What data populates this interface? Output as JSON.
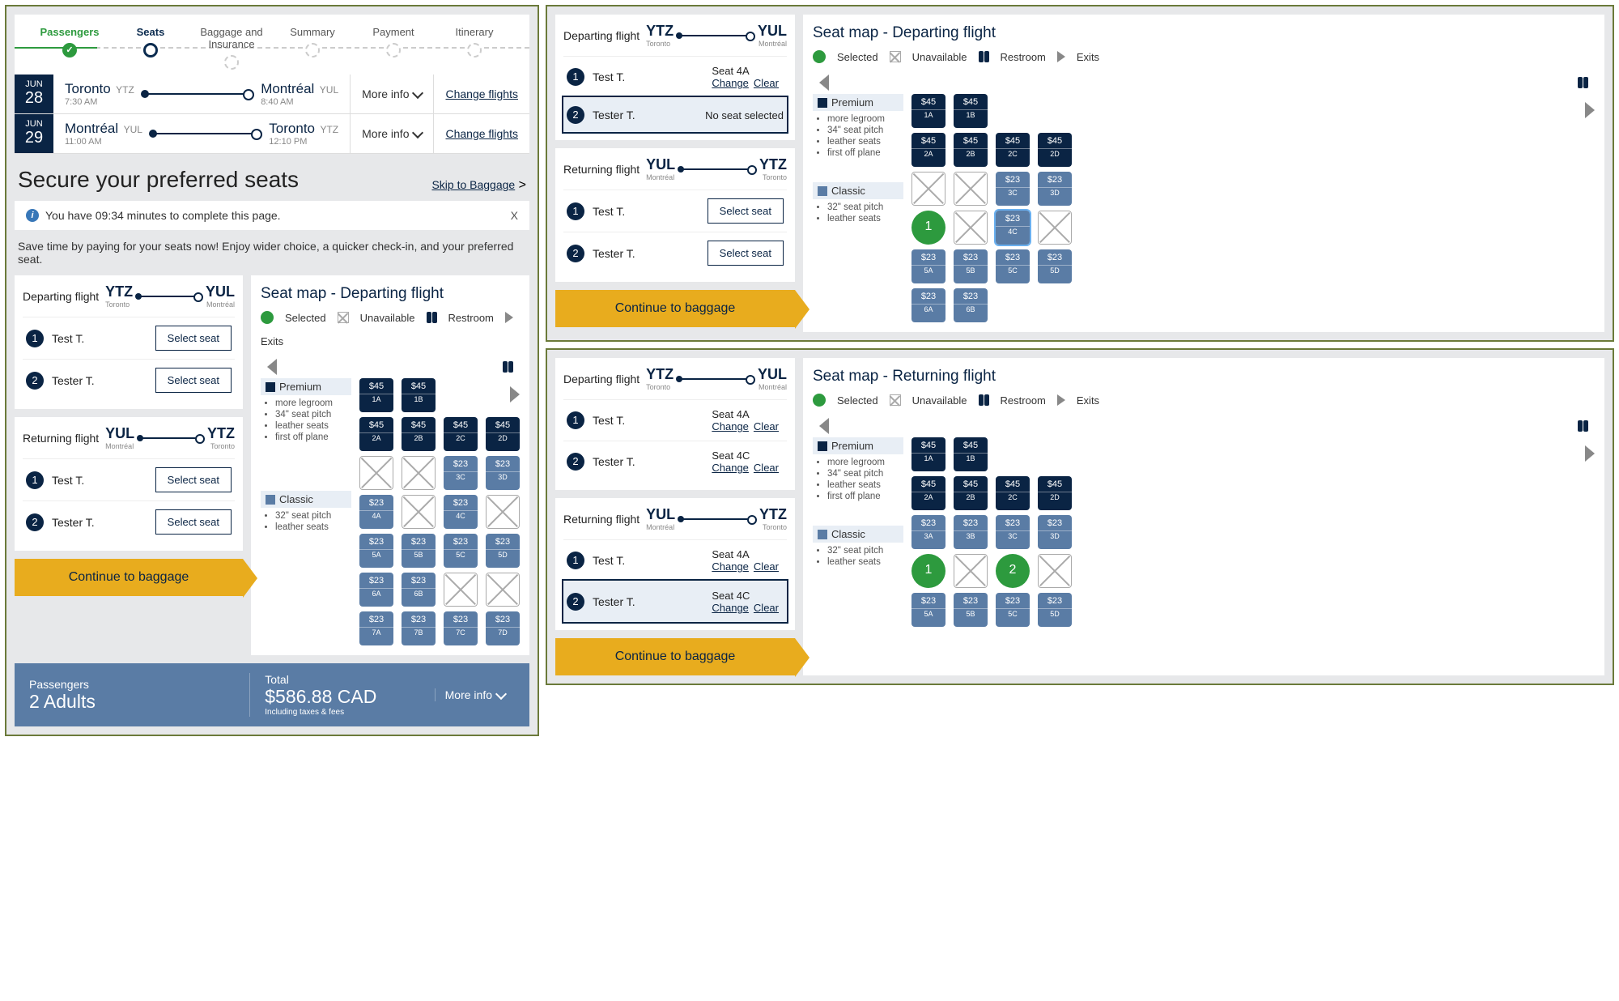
{
  "progress": {
    "steps": [
      "Passengers",
      "Seats",
      "Baggage and Insurance",
      "Summary",
      "Payment",
      "Itinerary"
    ]
  },
  "flights": [
    {
      "month": "JUN",
      "day": "28",
      "fromCity": "Toronto",
      "fromCode": "YTZ",
      "fromTime": "7:30 AM",
      "toCity": "Montréal",
      "toCode": "YUL",
      "toTime": "8:40 AM"
    },
    {
      "month": "JUN",
      "day": "29",
      "fromCity": "Montréal",
      "fromCode": "YUL",
      "fromTime": "11:00 AM",
      "toCity": "Toronto",
      "toCode": "YTZ",
      "toTime": "12:10 PM"
    }
  ],
  "labels": {
    "moreInfo": "More info",
    "changeFlights": "Change flights",
    "heading": "Secure your preferred seats",
    "skip": "Skip to Baggage",
    "skipArrow": ">",
    "infoMsg": "You have 09:34 minutes to complete this page.",
    "close": "X",
    "note": "Save time by paying for your seats now! Enjoy wider choice, a quicker check-in, and your preferred seat.",
    "departing": "Departing flight",
    "returning": "Returning flight",
    "selectSeat": "Select seat",
    "noSeat": "No seat selected",
    "change": "Change",
    "clear": "Clear",
    "continue": "Continue to baggage",
    "seatmapDep": "Seat map - Departing flight",
    "seatmapRet": "Seat map - Returning flight",
    "selected": "Selected",
    "unavailable": "Unavailable",
    "restroom": "Restroom",
    "exits": "Exits",
    "premium": "Premium",
    "classic": "Classic",
    "seat4A": "Seat 4A",
    "seat4C": "Seat 4C"
  },
  "routes": {
    "dep": {
      "fromCode": "YTZ",
      "fromCity": "Toronto",
      "toCode": "YUL",
      "toCity": "Montréal"
    },
    "ret": {
      "fromCode": "YUL",
      "fromCity": "Montréal",
      "toCode": "YTZ",
      "toCity": "Toronto"
    }
  },
  "pax": [
    "Test T.",
    "Tester T."
  ],
  "premiumFeatures": [
    "more legroom",
    "34\" seat pitch",
    "leather seats",
    "first off plane"
  ],
  "classicFeatures": [
    "32\" seat pitch",
    "leather seats"
  ],
  "seatPrices": {
    "premium": "$45",
    "classic": "$23"
  },
  "bottom": {
    "paxLabel": "Passengers",
    "paxValue": "2 Adults",
    "totalLabel": "Total",
    "totalValue": "$586.88 CAD",
    "totalSub": "Including taxes & fees",
    "more": "More info"
  },
  "panel1_map": [
    {
      "class": "premium",
      "cells": [
        {
          "p": "$45",
          "l": "1A"
        },
        {
          "p": "$45",
          "l": "1B"
        }
      ]
    },
    {
      "class": "premium",
      "cells": [
        {
          "p": "$45",
          "l": "2A"
        },
        {
          "p": "$45",
          "l": "2B"
        },
        {
          "p": "$45",
          "l": "2C"
        },
        {
          "p": "$45",
          "l": "2D"
        }
      ]
    },
    {
      "class": "classic",
      "cells": [
        {
          "u": true
        },
        {
          "u": true
        },
        {
          "p": "$23",
          "l": "3C"
        },
        {
          "p": "$23",
          "l": "3D"
        }
      ]
    },
    {
      "class": "classic",
      "cells": [
        {
          "p": "$23",
          "l": "4A"
        },
        {
          "u": true
        },
        {
          "p": "$23",
          "l": "4C"
        },
        {
          "u": true
        }
      ]
    },
    {
      "class": "classic",
      "cells": [
        {
          "p": "$23",
          "l": "5A"
        },
        {
          "p": "$23",
          "l": "5B"
        },
        {
          "p": "$23",
          "l": "5C"
        },
        {
          "p": "$23",
          "l": "5D"
        }
      ]
    },
    {
      "class": "classic",
      "cells": [
        {
          "p": "$23",
          "l": "6A"
        },
        {
          "p": "$23",
          "l": "6B"
        },
        {
          "u": true
        },
        {
          "u": true
        }
      ]
    },
    {
      "class": "classic",
      "cells": [
        {
          "p": "$23",
          "l": "7A"
        },
        {
          "p": "$23",
          "l": "7B"
        },
        {
          "p": "$23",
          "l": "7C"
        },
        {
          "p": "$23",
          "l": "7D"
        }
      ]
    }
  ],
  "panel2_map": [
    {
      "class": "premium",
      "cells": [
        {
          "p": "$45",
          "l": "1A"
        },
        {
          "p": "$45",
          "l": "1B"
        }
      ]
    },
    {
      "class": "premium",
      "cells": [
        {
          "p": "$45",
          "l": "2A"
        },
        {
          "p": "$45",
          "l": "2B"
        },
        {
          "p": "$45",
          "l": "2C"
        },
        {
          "p": "$45",
          "l": "2D"
        }
      ]
    },
    {
      "class": "classic",
      "cells": [
        {
          "u": true
        },
        {
          "u": true
        },
        {
          "p": "$23",
          "l": "3C"
        },
        {
          "p": "$23",
          "l": "3D"
        }
      ]
    },
    {
      "class": "classic",
      "cells": [
        {
          "sel": "1"
        },
        {
          "u": true
        },
        {
          "p": "$23",
          "l": "4C",
          "hl": true
        },
        {
          "u": true
        }
      ]
    },
    {
      "class": "classic",
      "cells": [
        {
          "p": "$23",
          "l": "5A"
        },
        {
          "p": "$23",
          "l": "5B"
        },
        {
          "p": "$23",
          "l": "5C"
        },
        {
          "p": "$23",
          "l": "5D"
        }
      ]
    },
    {
      "class": "classic",
      "cells": [
        {
          "p": "$23",
          "l": "6A"
        },
        {
          "p": "$23",
          "l": "6B"
        }
      ]
    }
  ],
  "panel3_map": [
    {
      "class": "premium",
      "cells": [
        {
          "p": "$45",
          "l": "1A"
        },
        {
          "p": "$45",
          "l": "1B"
        }
      ]
    },
    {
      "class": "premium",
      "cells": [
        {
          "p": "$45",
          "l": "2A"
        },
        {
          "p": "$45",
          "l": "2B"
        },
        {
          "p": "$45",
          "l": "2C"
        },
        {
          "p": "$45",
          "l": "2D"
        }
      ]
    },
    {
      "class": "classic",
      "cells": [
        {
          "p": "$23",
          "l": "3A"
        },
        {
          "p": "$23",
          "l": "3B"
        },
        {
          "p": "$23",
          "l": "3C"
        },
        {
          "p": "$23",
          "l": "3D"
        }
      ]
    },
    {
      "class": "classic",
      "cells": [
        {
          "sel": "1"
        },
        {
          "u": true
        },
        {
          "sel": "2"
        },
        {
          "u": true
        }
      ]
    },
    {
      "class": "classic",
      "cells": [
        {
          "p": "$23",
          "l": "5A"
        },
        {
          "p": "$23",
          "l": "5B"
        },
        {
          "p": "$23",
          "l": "5C"
        },
        {
          "p": "$23",
          "l": "5D"
        }
      ]
    }
  ]
}
